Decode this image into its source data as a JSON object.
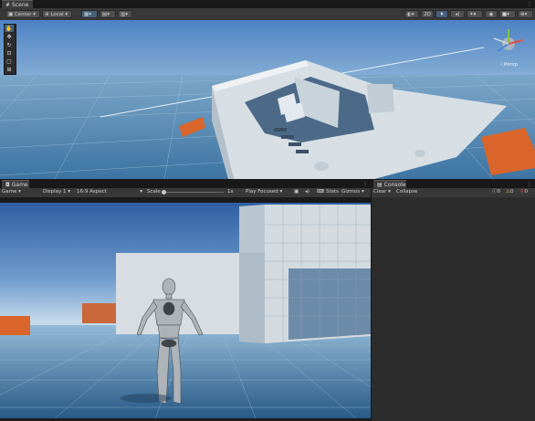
{
  "scene": {
    "tab_label": "Scene",
    "pivot_mode": "Center",
    "pivot_rotation": "Local",
    "toggle_2d": "2D",
    "persp_label": "‹ Persp",
    "tools": [
      "hand-tool-icon",
      "move-tool-icon",
      "rotate-tool-icon",
      "scale-tool-icon",
      "rect-tool-icon",
      "transform-tool-icon"
    ]
  },
  "game": {
    "tab_label": "Game",
    "display_mode": "Game",
    "display": "Display 1",
    "aspect": "16:9 Aspect",
    "scale_label": "Scale",
    "scale_value": "1x",
    "play_mode": "Play Focused",
    "stats_label": "Stats",
    "gizmos_label": "Gizmos"
  },
  "console": {
    "tab_label": "Console",
    "clear_label": "Clear",
    "collapse_label": "Collapse",
    "log_count": "0",
    "warning_count": "0",
    "error_count": "0"
  },
  "colors": {
    "sky_top": "#4d82c4",
    "sky_horizon": "#b6d0e6",
    "ground": "#3d74a2",
    "accent_orange": "#d9652b",
    "editor_bg": "#383838",
    "selected_blue": "#46607c"
  }
}
